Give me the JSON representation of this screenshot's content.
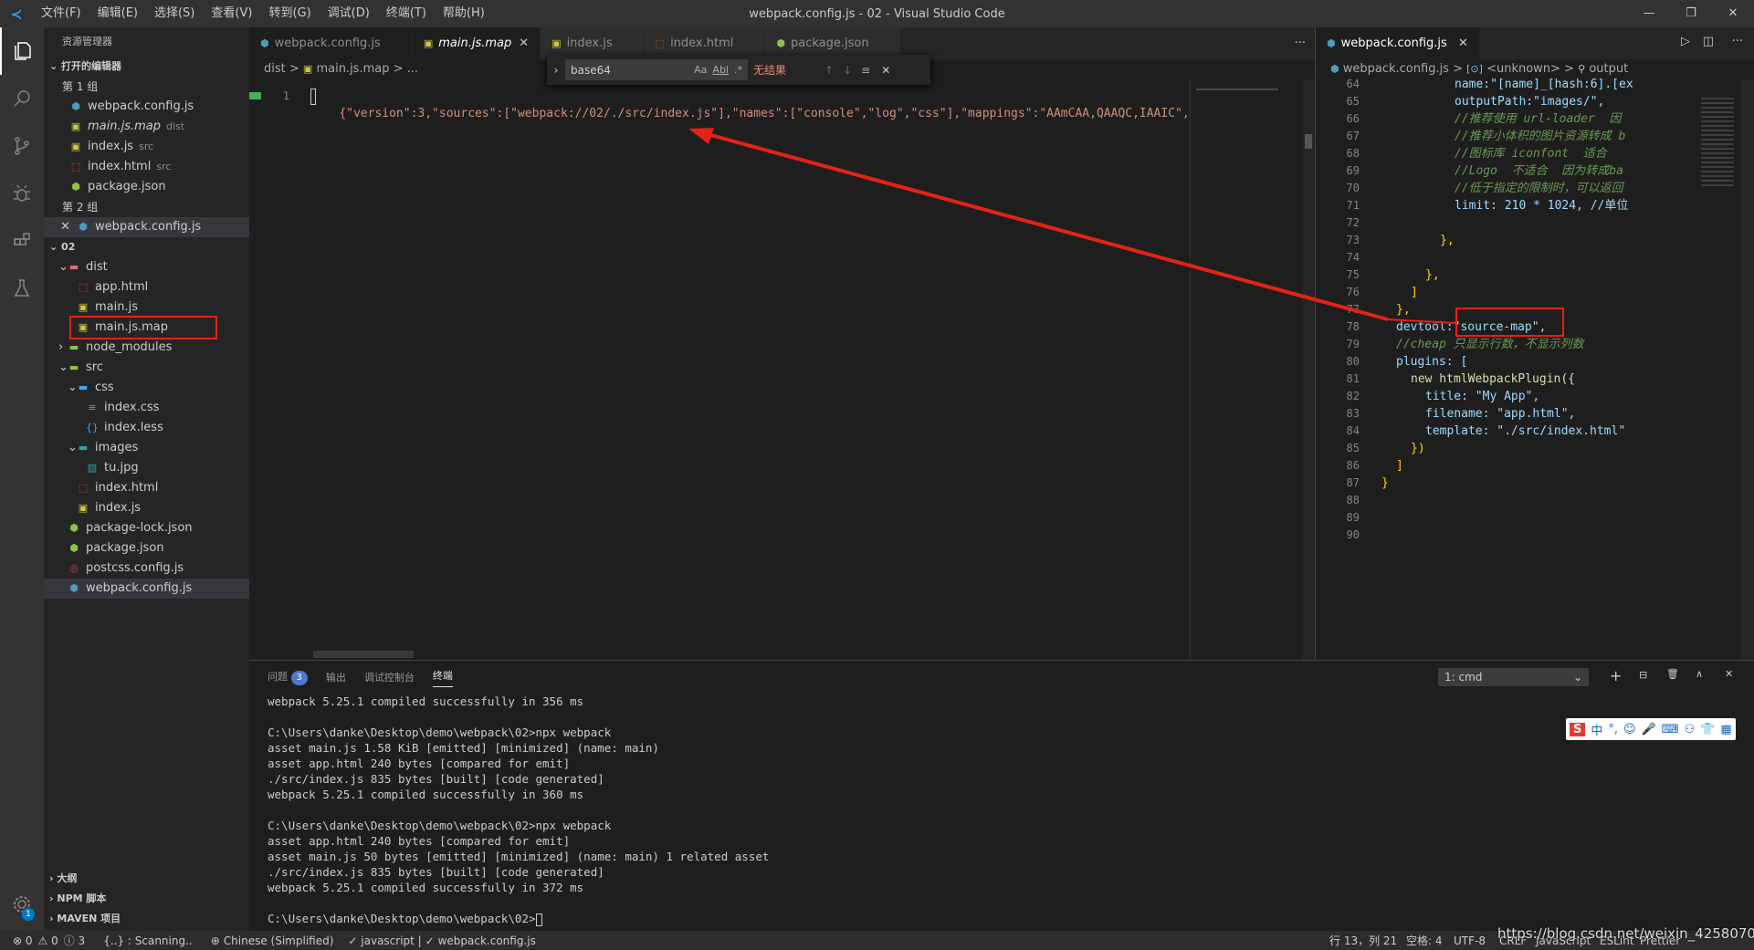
{
  "window": {
    "title": "webpack.config.js - 02 - Visual Studio Code",
    "app_icon": "vscode-icon"
  },
  "menu": [
    "文件(F)",
    "编辑(E)",
    "选择(S)",
    "查看(V)",
    "转到(G)",
    "调试(D)",
    "终端(T)",
    "帮助(H)"
  ],
  "window_controls": {
    "minimize": "—",
    "restore": "❐",
    "close": "✕"
  },
  "sidebar": {
    "title": "资源管理器",
    "open_editors_label": "打开的编辑器",
    "group1": "第 1 组",
    "group1_files": [
      {
        "name": "webpack.config.js",
        "desc": "",
        "icon": "⬢",
        "color": "#519aba"
      },
      {
        "name": "main.js.map",
        "desc": "dist",
        "icon": "▣",
        "color": "#cbcb41"
      },
      {
        "name": "index.js",
        "desc": "src",
        "icon": "▣",
        "color": "#cbcb41"
      },
      {
        "name": "index.html",
        "desc": "src",
        "icon": "⬚",
        "color": "#e44d26"
      },
      {
        "name": "package.json",
        "desc": "",
        "icon": "⬢",
        "color": "#8bc34a"
      }
    ],
    "group2": "第 2 组",
    "group2_files": [
      {
        "name": "webpack.config.js",
        "icon": "⬢",
        "color": "#519aba"
      }
    ],
    "project": "02",
    "tree": [
      {
        "name": "dist",
        "depth": 1,
        "icon": "▾",
        "kind": "folder",
        "color": "#e06c75"
      },
      {
        "name": "app.html",
        "depth": 2,
        "icon": "⬚",
        "color": "#e44d26"
      },
      {
        "name": "main.js",
        "depth": 2,
        "icon": "▣",
        "color": "#cbcb41"
      },
      {
        "name": "main.js.map",
        "depth": 2,
        "icon": "▣",
        "color": "#cbcb41"
      },
      {
        "name": "node_modules",
        "depth": 1,
        "icon": "▸",
        "kind": "folder",
        "color": "#8bc34a"
      },
      {
        "name": "src",
        "depth": 1,
        "icon": "▾",
        "kind": "folder",
        "color": "#8bc34a"
      },
      {
        "name": "css",
        "depth": 2,
        "icon": "▾",
        "kind": "folder",
        "color": "#42a5f5"
      },
      {
        "name": "index.css",
        "depth": 3,
        "icon": "≡",
        "color": "#42a5f5"
      },
      {
        "name": "index.less",
        "depth": 3,
        "icon": "{}",
        "color": "#42a5f5"
      },
      {
        "name": "images",
        "depth": 2,
        "icon": "▾",
        "kind": "folder",
        "color": "#26a69a"
      },
      {
        "name": "tu.jpg",
        "depth": 3,
        "icon": "▨",
        "color": "#26a69a"
      },
      {
        "name": "index.html",
        "depth": 2,
        "icon": "⬚",
        "color": "#e44d26"
      },
      {
        "name": "index.js",
        "depth": 2,
        "icon": "▣",
        "color": "#cbcb41"
      },
      {
        "name": "package-lock.json",
        "depth": 1,
        "icon": "⬢",
        "color": "#8bc34a"
      },
      {
        "name": "package.json",
        "depth": 1,
        "icon": "⬢",
        "color": "#8bc34a"
      },
      {
        "name": "postcss.config.js",
        "depth": 1,
        "icon": "◎",
        "color": "#e53935"
      },
      {
        "name": "webpack.config.js",
        "depth": 1,
        "icon": "⬢",
        "color": "#519aba"
      }
    ],
    "bottom_sections": [
      "大纲",
      "NPM 脚本",
      "MAVEN 项目"
    ]
  },
  "tabs": [
    {
      "label": "webpack.config.js",
      "icon": "⬢",
      "color": "#519aba"
    },
    {
      "label": "main.js.map",
      "icon": "▣",
      "color": "#cbcb41"
    },
    {
      "label": "index.js",
      "icon": "▣",
      "color": "#cbcb41"
    },
    {
      "label": "index.html",
      "icon": "⬚",
      "color": "#e44d26"
    },
    {
      "label": "package.json",
      "icon": "⬢",
      "color": "#8bc34a"
    }
  ],
  "editor": {
    "breadcrumb": [
      "dist",
      "main.js.map",
      "..."
    ],
    "line_number": "1",
    "code_line": "{\"version\":3,\"sources\":[\"webpack://02/./src/index.js\"],\"names\":[\"console\",\"log\",\"css\"],\"mappings\":\"AAmCAA,QAAQC,IAAIC\",\"file\"",
    "more_actions": "···"
  },
  "find_widget": {
    "value": "base64",
    "match_case": "Aa",
    "whole_word": "Abl",
    "regex": ".*",
    "result": "无结果"
  },
  "right_editor": {
    "tab": "webpack.config.js",
    "breadcrumb": [
      "webpack.config.js",
      "<unknown>",
      "output"
    ],
    "lines": [
      {
        "n": "64",
        "text": "name:\"[name]_[hash:6].[ex"
      },
      {
        "n": "65",
        "text": "outputPath:\"images/\","
      },
      {
        "n": "66",
        "text": "//推荐使用 url-loader  因"
      },
      {
        "n": "67",
        "text": "//推荐小体积的图片资源转成 b"
      },
      {
        "n": "68",
        "text": "//图标库 iconfont  适合"
      },
      {
        "n": "69",
        "text": "//Logo  不适合  因为转成ba"
      },
      {
        "n": "70",
        "text": "//低于指定的限制时，可以返回"
      },
      {
        "n": "71",
        "text": "limit: 210 * 1024, //单位"
      },
      {
        "n": "72",
        "text": ""
      },
      {
        "n": "73",
        "text": "},"
      },
      {
        "n": "74",
        "text": ""
      },
      {
        "n": "75",
        "text": "},"
      },
      {
        "n": "76",
        "text": "]"
      },
      {
        "n": "77",
        "text": "},"
      },
      {
        "n": "78",
        "text": "devtool:\"source-map\","
      },
      {
        "n": "79",
        "text": "//cheap 只显示行数，不显示列数"
      },
      {
        "n": "80",
        "text": "plugins: ["
      },
      {
        "n": "81",
        "text": "new htmlWebpackPlugin({"
      },
      {
        "n": "82",
        "text": "title: \"My App\","
      },
      {
        "n": "83",
        "text": "filename: \"app.html\","
      },
      {
        "n": "84",
        "text": "template: \"./src/index.html\""
      },
      {
        "n": "85",
        "text": "})"
      },
      {
        "n": "86",
        "text": "]"
      },
      {
        "n": "87",
        "text": "}"
      },
      {
        "n": "88",
        "text": ""
      },
      {
        "n": "89",
        "text": ""
      },
      {
        "n": "90",
        "text": ""
      }
    ]
  },
  "panel": {
    "tabs": [
      "问题",
      "输出",
      "调试控制台",
      "终端"
    ],
    "problems_count": "3",
    "terminal_select": "1: cmd",
    "actions": [
      "+",
      "⊟",
      "🗑",
      "∧",
      "✕"
    ],
    "terminal_lines": [
      "webpack 5.25.1 compiled successfully in 356 ms",
      "",
      "C:\\Users\\danke\\Desktop\\demo\\webpack\\02>npx webpack",
      "asset main.js 1.58 KiB [emitted] [minimized] (name: main)",
      "asset app.html 240 bytes [compared for emit]",
      "./src/index.js 835 bytes [built] [code generated]",
      "webpack 5.25.1 compiled successfully in 360 ms",
      "",
      "C:\\Users\\danke\\Desktop\\demo\\webpack\\02>npx webpack",
      "asset app.html 240 bytes [compared for emit]",
      "asset main.js 50 bytes [emitted] [minimized] (name: main) 1 related asset",
      "./src/index.js 835 bytes [built] [code generated]",
      "webpack 5.25.1 compiled successfully in 372 ms",
      "",
      "C:\\Users\\danke\\Desktop\\demo\\webpack\\02>"
    ]
  },
  "ime_toolbar": [
    "S",
    "中",
    "°,",
    "☺",
    "🎤",
    "⌨",
    "⚇",
    "👕",
    "▦"
  ],
  "statusbar": {
    "errors": "⊗ 0",
    "warnings": "⚠ 0",
    "info": "ⓘ 3",
    "scanning": "{..} : Scanning..",
    "language_pack": "Chinese (Simplified)",
    "language": "✓ javascript |",
    "file_check": "✓ webpack.config.js",
    "position": "行 13，列 21",
    "spaces": "空格: 4",
    "encoding": "UTF-8",
    "eol": "CRLF",
    "lang_mode": "JavaScript",
    "eslint": "ESLint",
    "prettier": "Prettier",
    "watermark": "https://blog.csdn.net/weixin_42580704"
  },
  "colors": {
    "accent": "#007acc",
    "annotation_red": "#e62117"
  }
}
